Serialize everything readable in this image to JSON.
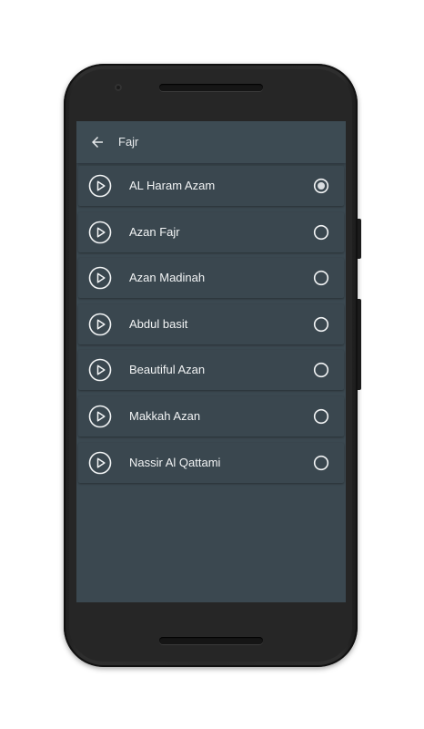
{
  "toolbar": {
    "title": "Fajr",
    "back_icon": "arrow-back-icon"
  },
  "list": {
    "items": [
      {
        "label": "AL Haram Azam",
        "selected": true
      },
      {
        "label": "Azan Fajr",
        "selected": false
      },
      {
        "label": "Azan Madinah",
        "selected": false
      },
      {
        "label": "Abdul basit",
        "selected": false
      },
      {
        "label": "Beautiful Azan",
        "selected": false
      },
      {
        "label": "Makkah Azan",
        "selected": false
      },
      {
        "label": "Nassir Al Qattami",
        "selected": false
      }
    ],
    "play_icon": "play-circle-icon"
  },
  "colors": {
    "screen_background": "#3b4850",
    "item_background": "#3a474f",
    "text": "#f2f4f5",
    "icon": "#e6e9eb"
  }
}
